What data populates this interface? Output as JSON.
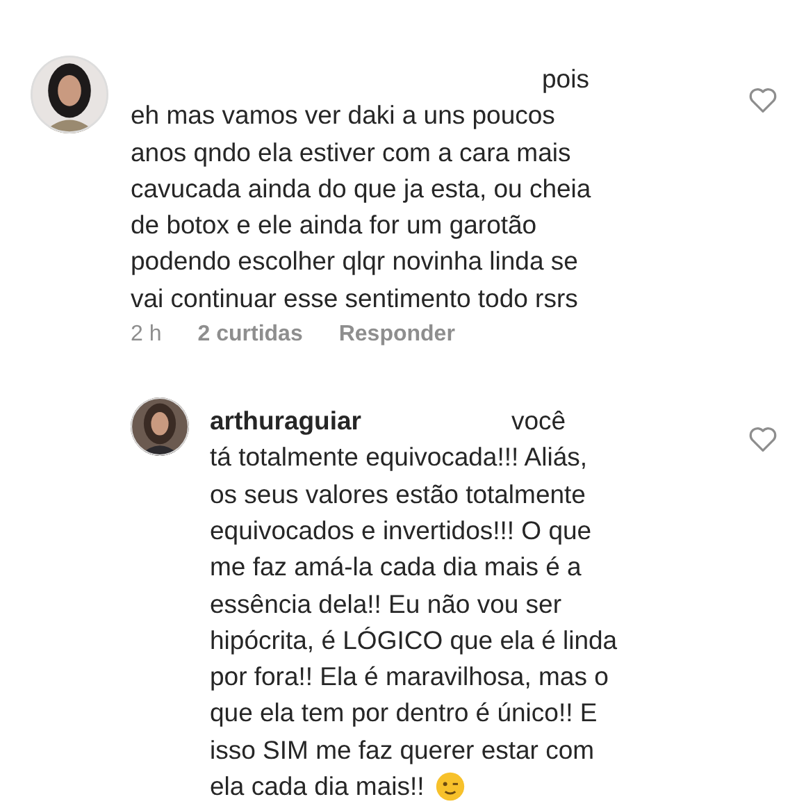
{
  "comments": [
    {
      "kind": "comment",
      "first_line": "pois",
      "lines": [
        "eh mas vamos ver daki a uns poucos",
        "anos qndo ela estiver com a cara mais",
        "cavucada ainda do que ja esta, ou cheia",
        "de botox e ele ainda for um garotão",
        "podendo escolher qlqr novinha linda se",
        "vai continuar esse sentimento todo rsrs"
      ],
      "time": "2 h",
      "likes": "2 curtidas",
      "reply": "Responder",
      "liked": false
    },
    {
      "kind": "reply",
      "username": "arthuraguiar",
      "first_line": "você",
      "lines": [
        "tá totalmente equivocada!!! Aliás,",
        "os seus valores estão totalmente",
        "equivocados e invertidos!!! O que",
        "me faz amá-la cada dia mais é a",
        "essência dela!! Eu não vou ser",
        "hipócrita, é LÓGICO que ela é linda",
        "por fora!! Ela é maravilhosa, mas o",
        "que ela tem por dentro é único!! E",
        "isso SIM me faz querer estar com",
        "ela cada dia mais!!"
      ],
      "liked": false,
      "emoji": true
    }
  ]
}
